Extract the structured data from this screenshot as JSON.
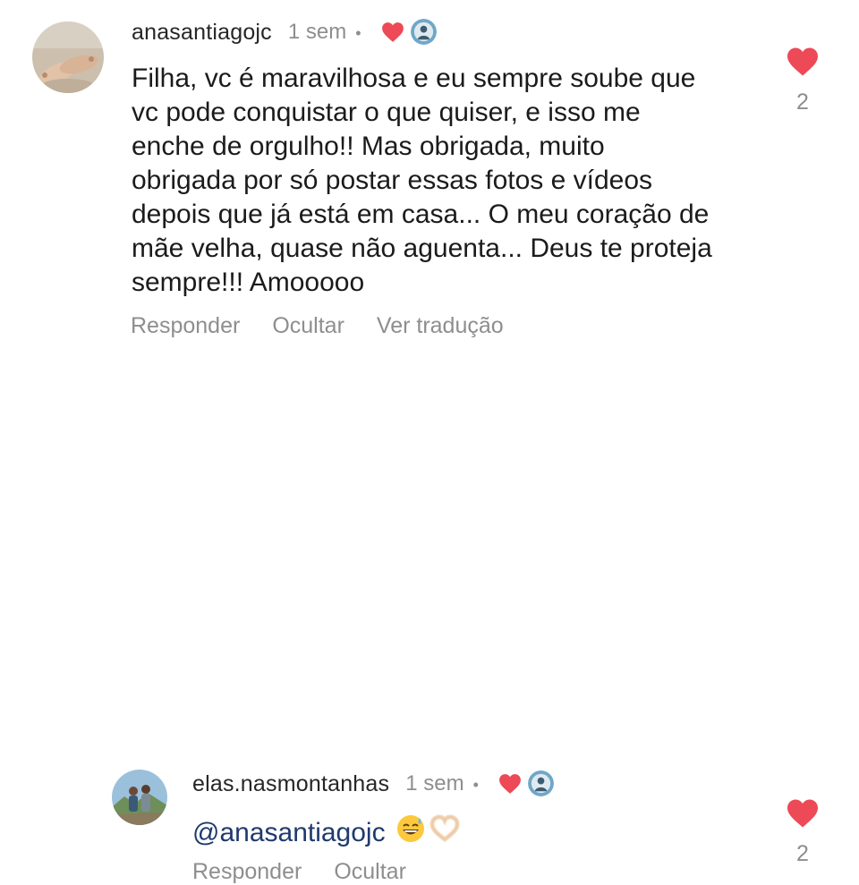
{
  "comments": [
    {
      "username": "anasantiagojc",
      "time": "1 sem",
      "separator": "•",
      "text": "Filha, vc é maravilhosa e eu sempre soube que\nvc pode conquistar o que quiser, e isso me\nenche de orgulho!! Mas obrigada, muito\nobrigada por só postar essas fotos e vídeos\ndepois que já está em casa... O meu coração de\nmãe velha, quase não aguenta... Deus te proteja\nsempre!!! Amooooo",
      "actions": {
        "reply": "Responder",
        "hide": "Ocultar",
        "translate": "Ver tradução"
      },
      "like_count": "2",
      "author_liked": true,
      "avatar_icon": "avatar-beach-feet",
      "heart_color": "#ed4956"
    },
    {
      "username": "elas.nasmontanhas",
      "time": "1 sem",
      "separator": "•",
      "mention": "@anasantiagojc",
      "emojis": [
        "grinning-sweat-emoji",
        "heart-hands-emoji"
      ],
      "actions": {
        "reply": "Responder",
        "hide": "Ocultar"
      },
      "like_count": "2",
      "author_liked": true,
      "avatar_icon": "avatar-mountain-couple",
      "heart_color": "#ed4956",
      "mention_color": "#1f3a6e"
    }
  ]
}
